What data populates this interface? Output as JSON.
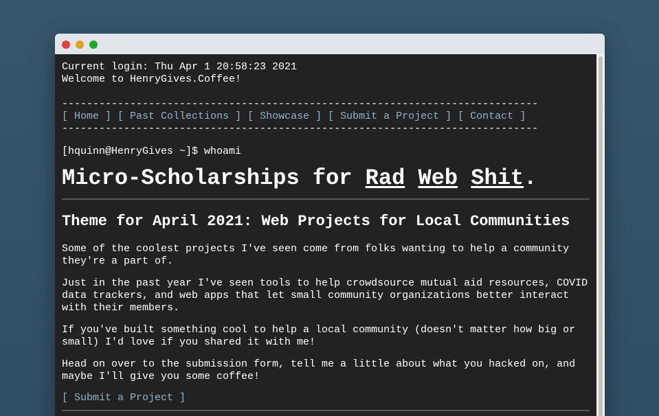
{
  "window": {
    "buttons": [
      "close",
      "minimize",
      "maximize"
    ]
  },
  "terminal": {
    "login_line": "Current login: Thu Apr 1 20:58:23 2021",
    "welcome_line": "Welcome to HenryGives.Coffee!",
    "divider": "-----------------------------------------------------------------------------",
    "nav": {
      "open": "[ ",
      "close": " ]",
      "sep": " ] [ ",
      "items": [
        "Home",
        "Past Collections",
        "Showcase",
        "Submit a Project",
        "Contact"
      ]
    },
    "prompt": "[hquinn@HenryGives ~]$ whoami"
  },
  "headline": {
    "prefix": "Micro-Scholarships for ",
    "word1": "Rad",
    "space1": " ",
    "word2": "Web",
    "space2": " ",
    "word3": "Shit",
    "suffix": "."
  },
  "theme_title": "Theme for April 2021: Web Projects for Local Communities",
  "paragraphs": [
    "Some of the coolest projects I've seen come from folks wanting to help a community they're a part of.",
    "Just in the past year I've seen tools to help crowdsource mutual aid resources, COVID data trackers, and web apps that let small community organizations better interact with their members.",
    "If you've built something cool to help a local community (doesn't matter how big or small) I'd love if you shared it with me!",
    "Head on over to the submission form, tell me a little about what you hacked on, and maybe I'll give you some coffee!"
  ],
  "submit_link": "[ Submit a Project ]",
  "colors": {
    "terminal_bg": "#222222",
    "link": "#8fb4c8",
    "desktop_bg": "#345469"
  }
}
